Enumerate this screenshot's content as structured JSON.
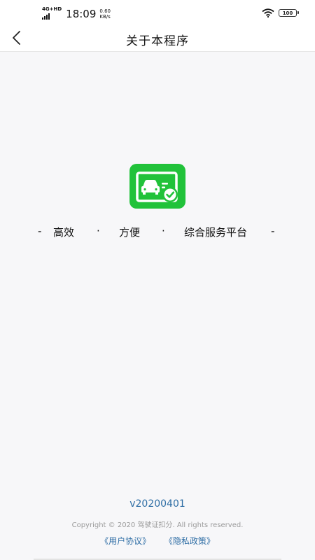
{
  "status_bar": {
    "network": "4G+HD",
    "time": "18:09",
    "speed_value": "0.60",
    "speed_unit": "KB/s",
    "battery": "100"
  },
  "nav": {
    "title": "关于本程序"
  },
  "app": {
    "icon": "license-card-check-icon",
    "brand_color": "#21c23a"
  },
  "slogan": {
    "dash_left": "-",
    "item1": "高效",
    "dot1": "·",
    "item2": "方便",
    "dot2": "·",
    "item3": "综合服务平台",
    "dash_right": "-"
  },
  "footer": {
    "version": "v20200401",
    "copyright": "Copyright © 2020 驾驶证扣分. All rights reserved.",
    "user_agreement": "《用户协议》",
    "privacy_policy": "《隐私政策》",
    "link_color": "#2f6ea5"
  }
}
